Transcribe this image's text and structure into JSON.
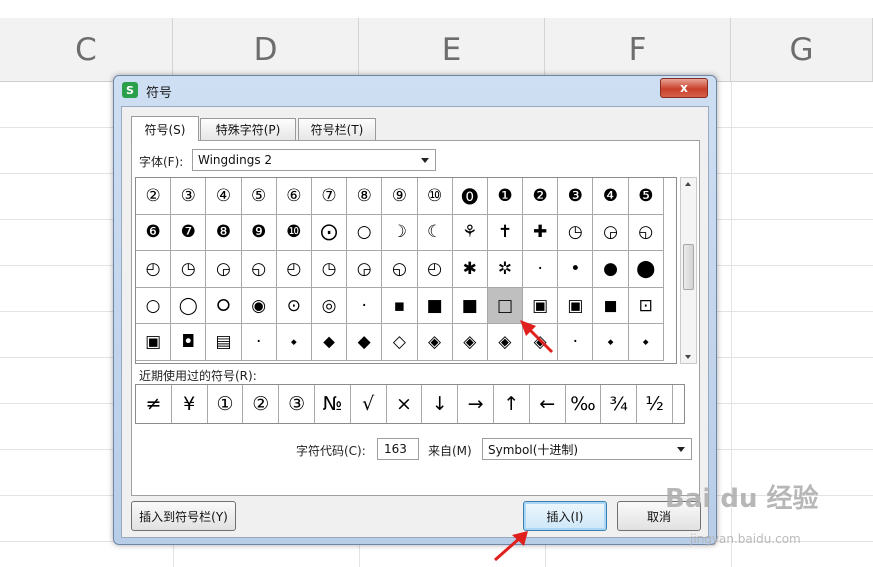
{
  "spreadsheet": {
    "columns": [
      "C",
      "D",
      "E",
      "F",
      "G"
    ]
  },
  "dialog": {
    "title": "符号",
    "app_icon_letter": "S",
    "close_glyph": "x",
    "tabs": [
      {
        "label": "符号(S)",
        "active": true
      },
      {
        "label": "特殊字符(P)",
        "active": false
      },
      {
        "label": "符号栏(T)",
        "active": false
      }
    ],
    "font_label": "字体(F):",
    "font_value": "Wingdings 2",
    "symbols": [
      [
        "②",
        "③",
        "④",
        "⑤",
        "⑥",
        "⑦",
        "⑧",
        "⑨",
        "⑩",
        "⓿",
        "❶",
        "❷",
        "❸",
        "❹",
        "❺"
      ],
      [
        "❻",
        "❼",
        "❽",
        "❾",
        "❿",
        "⨀",
        "○",
        "☽",
        "☾",
        "⚘",
        "✝",
        "✚",
        "◷",
        "◶",
        "◵"
      ],
      [
        "◴",
        "◷",
        "◶",
        "◵",
        "◴",
        "◷",
        "◶",
        "◵",
        "◴",
        "✱",
        "✲",
        "·",
        "•",
        "●",
        "⬤"
      ],
      [
        "○",
        "◯",
        "⭘",
        "◉",
        "⊙",
        "◎",
        "·",
        "▪",
        "■",
        "■",
        "□",
        "▣",
        "▣",
        "◼",
        "⊡"
      ],
      [
        "▣",
        "◘",
        "▤",
        "·",
        "⬩",
        "⬥",
        "◆",
        "◇",
        "◈",
        "◈",
        "◈",
        "◈",
        "·",
        "⬩",
        "⬩"
      ]
    ],
    "selected_symbol": "□",
    "recent_label": "近期使用过的符号(R):",
    "recent_symbols": [
      "≠",
      "¥",
      "①",
      "②",
      "③",
      "№",
      "√",
      "×",
      "↓",
      "→",
      "↑",
      "←",
      "‰",
      "¾",
      "½"
    ],
    "char_code_label": "字符代码(C):",
    "char_code_value": "163",
    "from_label": "来自(M)",
    "from_value": "Symbol(十进制)",
    "insert_to_bar_button": "插入到符号栏(Y)",
    "insert_button": "插入(I)",
    "cancel_button": "取消"
  },
  "watermark": {
    "logo": "Bai du 经验",
    "url": "jingyan.baidu.com"
  },
  "colors": {
    "accent_arrow": "#e0201c",
    "dialog_frame": "#b8cde8",
    "selection": "#bfbfbf"
  }
}
